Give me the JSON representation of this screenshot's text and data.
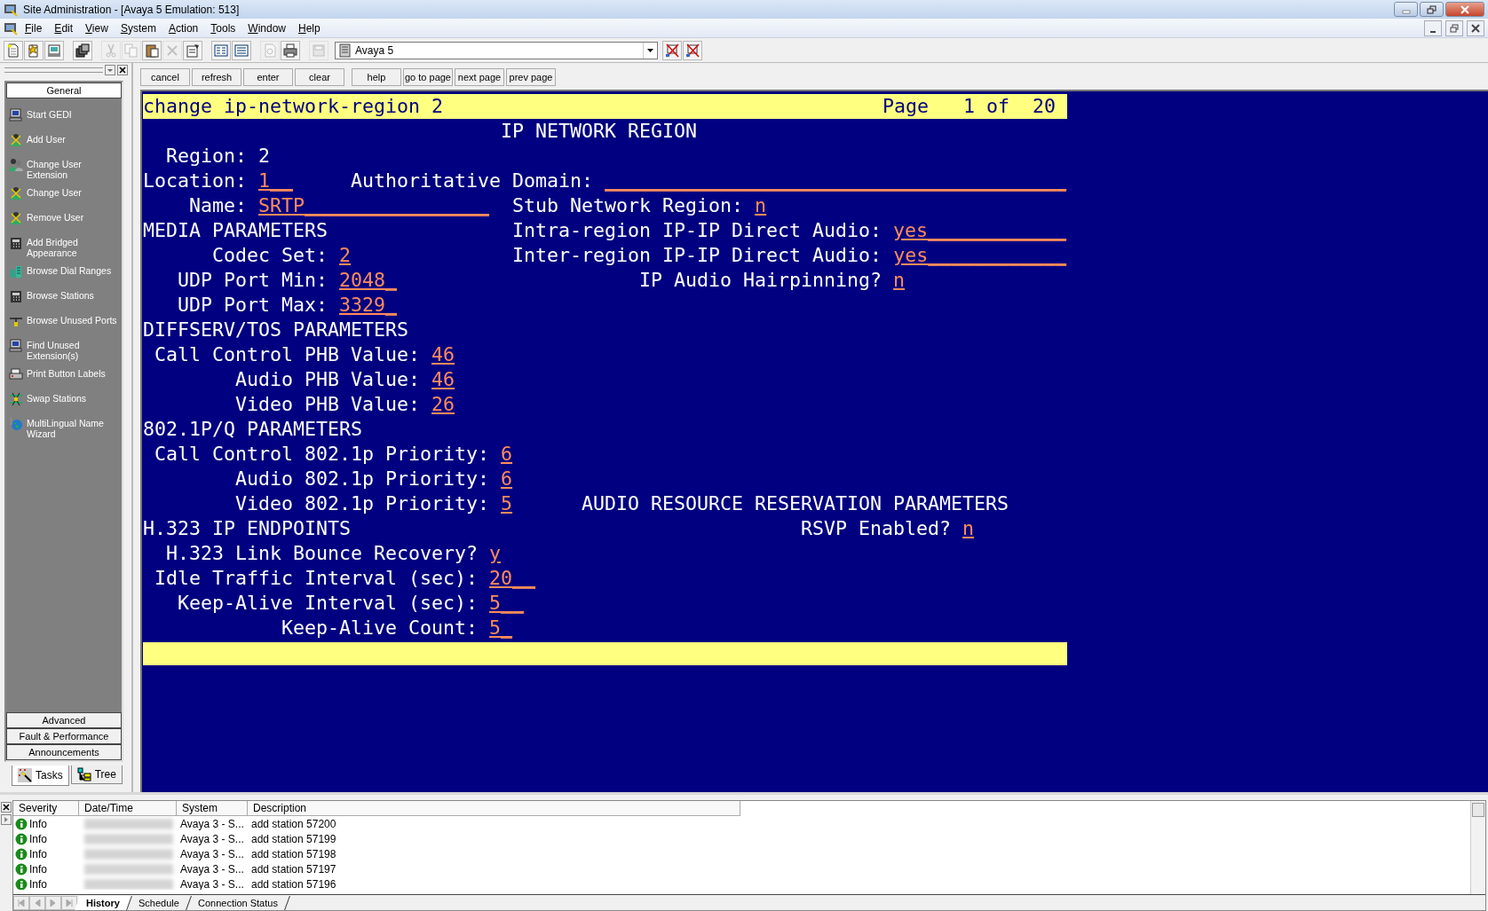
{
  "window": {
    "title": "Site Administration - [Avaya 5 Emulation: 513]"
  },
  "menu": [
    "File",
    "Edit",
    "View",
    "System",
    "Action",
    "Tools",
    "Window",
    "Help"
  ],
  "toolbar": {
    "buttons": [
      {
        "disabled": false
      },
      {
        "disabled": false
      },
      {
        "disabled": false
      },
      {
        "disabled": false
      },
      {
        "disabled": true
      },
      {
        "disabled": true
      },
      {
        "disabled": false
      },
      {
        "disabled": true
      },
      {
        "disabled": false
      },
      {
        "disabled": false
      },
      {
        "disabled": false
      },
      {
        "disabled": true
      },
      {
        "disabled": false
      },
      {
        "disabled": true
      }
    ],
    "system": "Avaya 5"
  },
  "tasks": {
    "groups_top": [
      {
        "label": "General",
        "selected": true
      }
    ],
    "items": [
      "Start GEDI",
      "Add User",
      "Change User Extension",
      "Change User",
      "Remove User",
      "Add Bridged Appearance",
      "Browse Dial Ranges",
      "Browse Stations",
      "Browse Unused Ports",
      "Find Unused Extension(s)",
      "Print Button Labels",
      "Swap Stations",
      "MultiLingual Name Wizard"
    ],
    "groups_bottom": [
      "Advanced",
      "Fault & Performance",
      "Announcements"
    ],
    "tabs": [
      {
        "label": "Tasks",
        "selected": true
      },
      {
        "label": "Tree",
        "selected": false
      }
    ]
  },
  "commands": [
    "cancel",
    "refresh",
    "enter",
    "clear",
    "help",
    "go to page",
    "next page",
    "prev page"
  ],
  "terminal": {
    "command": "change ip-network-region 2",
    "page": "Page   1 of  20",
    "lines": [
      [
        {
          "kind": "label",
          "text": "                               IP NETWORK REGION"
        }
      ],
      [
        {
          "kind": "label",
          "text": "  Region: 2"
        }
      ],
      [
        {
          "kind": "label",
          "text": "Location: "
        },
        {
          "kind": "field",
          "text": "1__"
        },
        {
          "kind": "label",
          "text": "     Authoritative Domain: "
        },
        {
          "kind": "field",
          "text": "________________________________________"
        }
      ],
      [
        {
          "kind": "label",
          "text": "    Name: "
        },
        {
          "kind": "field",
          "text": "SRTP________________"
        },
        {
          "kind": "label",
          "text": "  Stub Network Region: "
        },
        {
          "kind": "field",
          "text": "n"
        }
      ],
      [
        {
          "kind": "label",
          "text": "MEDIA PARAMETERS"
        },
        {
          "kind": "label",
          "text": "                Intra-region IP-IP Direct Audio: "
        },
        {
          "kind": "field",
          "text": "yes____________"
        }
      ],
      [
        {
          "kind": "label",
          "text": "      Codec Set: "
        },
        {
          "kind": "field",
          "text": "2"
        },
        {
          "kind": "label",
          "text": "              Inter-region IP-IP Direct Audio: "
        },
        {
          "kind": "field",
          "text": "yes____________"
        }
      ],
      [
        {
          "kind": "label",
          "text": "   UDP Port Min: "
        },
        {
          "kind": "field",
          "text": "2048_"
        },
        {
          "kind": "label",
          "text": "                     IP Audio Hairpinning? "
        },
        {
          "kind": "field",
          "text": "n"
        }
      ],
      [
        {
          "kind": "label",
          "text": "   UDP Port Max: "
        },
        {
          "kind": "field",
          "text": "3329_"
        }
      ],
      [
        {
          "kind": "label",
          "text": "DIFFSERV/TOS PARAMETERS"
        }
      ],
      [
        {
          "kind": "label",
          "text": " Call Control PHB Value: "
        },
        {
          "kind": "field",
          "text": "46"
        }
      ],
      [
        {
          "kind": "label",
          "text": "        Audio PHB Value: "
        },
        {
          "kind": "field",
          "text": "46"
        }
      ],
      [
        {
          "kind": "label",
          "text": "        Video PHB Value: "
        },
        {
          "kind": "field",
          "text": "26"
        }
      ],
      [
        {
          "kind": "label",
          "text": "802.1P/Q PARAMETERS"
        }
      ],
      [
        {
          "kind": "label",
          "text": " Call Control 802.1p Priority: "
        },
        {
          "kind": "field",
          "text": "6"
        }
      ],
      [
        {
          "kind": "label",
          "text": "        Audio 802.1p Priority: "
        },
        {
          "kind": "field",
          "text": "6"
        }
      ],
      [
        {
          "kind": "label",
          "text": "        Video 802.1p Priority: "
        },
        {
          "kind": "field",
          "text": "5"
        },
        {
          "kind": "label",
          "text": "      AUDIO RESOURCE RESERVATION PARAMETERS"
        }
      ],
      [
        {
          "kind": "label",
          "text": "H.323 IP ENDPOINTS"
        },
        {
          "kind": "label",
          "text": "                                       RSVP Enabled? "
        },
        {
          "kind": "field",
          "text": "n"
        }
      ],
      [
        {
          "kind": "label",
          "text": "  H.323 Link Bounce Recovery? "
        },
        {
          "kind": "field",
          "text": "y"
        }
      ],
      [
        {
          "kind": "label",
          "text": " Idle Traffic Interval (sec): "
        },
        {
          "kind": "field",
          "text": "20__"
        }
      ],
      [
        {
          "kind": "label",
          "text": "   Keep-Alive Interval (sec): "
        },
        {
          "kind": "field",
          "text": "5__"
        }
      ],
      [
        {
          "kind": "label",
          "text": "            Keep-Alive Count: "
        },
        {
          "kind": "field",
          "text": "5_"
        }
      ]
    ]
  },
  "log": {
    "columns": [
      "Severity",
      "Date/Time",
      "System",
      "Description"
    ],
    "rows": [
      {
        "severity": "Info",
        "system": "Avaya 3 - S...",
        "description": "add station 57200"
      },
      {
        "severity": "Info",
        "system": "Avaya 3 - S...",
        "description": "add station 57199"
      },
      {
        "severity": "Info",
        "system": "Avaya 3 - S...",
        "description": "add station 57198"
      },
      {
        "severity": "Info",
        "system": "Avaya 3 - S...",
        "description": "add station 57197"
      },
      {
        "severity": "Info",
        "system": "Avaya 3 - S...",
        "description": "add station 57196"
      }
    ],
    "tabs": [
      {
        "label": "History",
        "selected": true
      },
      {
        "label": "Schedule",
        "selected": false
      },
      {
        "label": "Connection Status",
        "selected": false
      }
    ]
  }
}
